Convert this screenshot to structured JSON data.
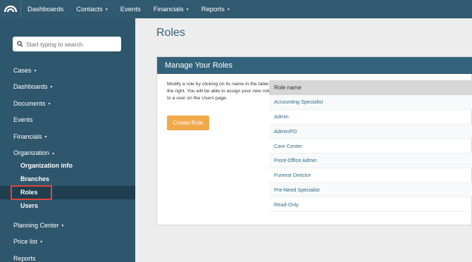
{
  "topnav": {
    "items": [
      {
        "label": "Dashboards",
        "has_caret": false
      },
      {
        "label": "Contacts",
        "has_caret": true
      },
      {
        "label": "Events",
        "has_caret": false
      },
      {
        "label": "Financials",
        "has_caret": true
      },
      {
        "label": "Reports",
        "has_caret": true
      }
    ],
    "caret": "▾"
  },
  "sidebar": {
    "search_placeholder": "Start typing to search",
    "items": [
      {
        "label": "Cases"
      },
      {
        "label": "Dashboards"
      },
      {
        "label": "Documents"
      },
      {
        "label": "Events"
      },
      {
        "label": "Financials"
      },
      {
        "label": "Organization"
      },
      {
        "label": "Organization info"
      },
      {
        "label": "Branches"
      },
      {
        "label": "Roles"
      },
      {
        "label": "Users"
      },
      {
        "label": "Planning Center"
      },
      {
        "label": "Price list"
      },
      {
        "label": "Reports"
      }
    ],
    "caret_down": "▾",
    "caret_up": "▴"
  },
  "page": {
    "title": "Roles",
    "panel_title": "Manage Your Roles",
    "description": "Modify a role by clicking on its name in the table to the right. You will be able to assign your new role to a user on the Users page.",
    "create_button": "Create Role"
  },
  "roles_table": {
    "header": "Role name",
    "rows": [
      "Accounting Specialist",
      "Admin",
      "Admin/FD",
      "Care Center",
      "Front-Office Admin",
      "Funeral Director",
      "Pre-Need Specialist",
      "Read-Only"
    ]
  },
  "colors": {
    "topbar": "#31596f",
    "sidebar": "#2e566c",
    "accent": "#33627c",
    "button": "#f0a94a",
    "highlight_box": "#e0453a"
  }
}
